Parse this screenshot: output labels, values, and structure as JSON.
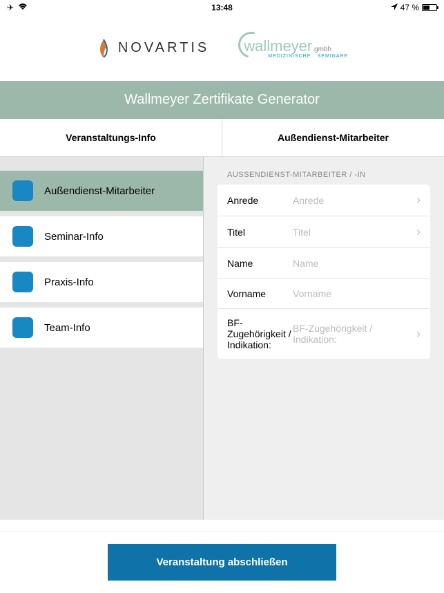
{
  "statusBar": {
    "time": "13:48",
    "battery": "47 %"
  },
  "logos": {
    "novartis": "NOVARTIS",
    "wallmeyer": "wallmeyer",
    "wallmeyerSuffix": ".gmbh",
    "wallmeyerSub": "MEDIZINISCHE · SEMINARE"
  },
  "banner": {
    "title": "Wallmeyer Zertifikate Generator"
  },
  "tabs": {
    "left": "Veranstaltungs-Info",
    "right": "Außendienst-Mitarbeiter"
  },
  "sidebar": {
    "items": [
      {
        "label": "Außendienst-Mitarbeiter"
      },
      {
        "label": "Seminar-Info"
      },
      {
        "label": "Praxis-Info"
      },
      {
        "label": "Team-Info"
      }
    ]
  },
  "form": {
    "sectionTitle": "AUSSENDIENST-MITARBEITER / -IN",
    "rows": [
      {
        "label": "Anrede",
        "placeholder": "Anrede",
        "hasChevron": true
      },
      {
        "label": "Titel",
        "placeholder": "Titel",
        "hasChevron": true
      },
      {
        "label": "Name",
        "placeholder": "Name",
        "hasChevron": false
      },
      {
        "label": "Vorname",
        "placeholder": "Vorname",
        "hasChevron": false
      },
      {
        "label": "BF-Zugehörigkeit / Indikation:",
        "placeholder": "BF-Zugehörigkeit / Indikation:",
        "hasChevron": true
      }
    ]
  },
  "submit": {
    "label": "Veranstaltung abschließen"
  }
}
